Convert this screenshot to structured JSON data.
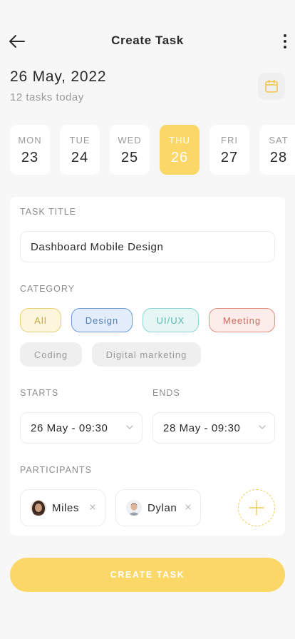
{
  "header": {
    "title": "Create Task",
    "back_icon": "arrow-left-icon",
    "more_icon": "more-vertical-icon"
  },
  "date": {
    "title": "26 May, 2022",
    "subtitle": "12 tasks today",
    "calendar_icon": "calendar-icon"
  },
  "days": [
    {
      "name": "MON",
      "num": "23",
      "active": false
    },
    {
      "name": "TUE",
      "num": "24",
      "active": false
    },
    {
      "name": "WED",
      "num": "25",
      "active": false
    },
    {
      "name": "THU",
      "num": "26",
      "active": true
    },
    {
      "name": "FRI",
      "num": "27",
      "active": false
    },
    {
      "name": "SAT",
      "num": "28",
      "active": false
    }
  ],
  "form": {
    "task_title_label": "TASK TITLE",
    "task_title_value": "Dashboard Mobile Design",
    "category_label": "CATEGORY",
    "categories": [
      "All",
      "Design",
      "UI/UX",
      "Meeting",
      "Coding",
      "Digital marketing"
    ],
    "starts_label": "STARTS",
    "starts_value": "26 May - 09:30",
    "ends_label": "ENDS",
    "ends_value": "28 May - 09:30",
    "participants_label": "PARTICIPANTS",
    "participants": [
      "Miles",
      "Dylan"
    ]
  },
  "actions": {
    "create_label": "CREATE TASK"
  },
  "colors": {
    "accent": "#fad766",
    "background": "#f7f7f7",
    "card": "#ffffff"
  }
}
